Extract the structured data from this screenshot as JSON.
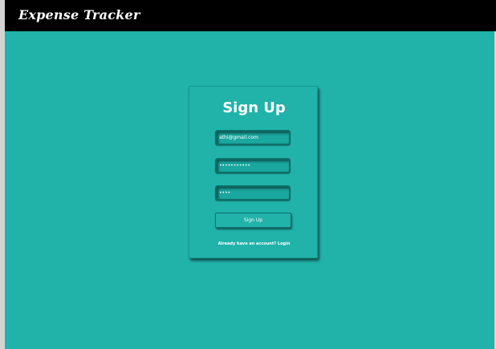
{
  "app": {
    "title": "Expense Tracker"
  },
  "signup": {
    "heading": "Sign Up",
    "email_value": "athi@gmail.com",
    "password_value": "•••••••••••",
    "confirm_value": "••••",
    "submit_label": "Sign Up",
    "footer_text": "Already have an account?",
    "login_label": "Login"
  },
  "colors": {
    "background": "#21b2aa",
    "navbar": "#000000",
    "text": "#ffffff"
  }
}
